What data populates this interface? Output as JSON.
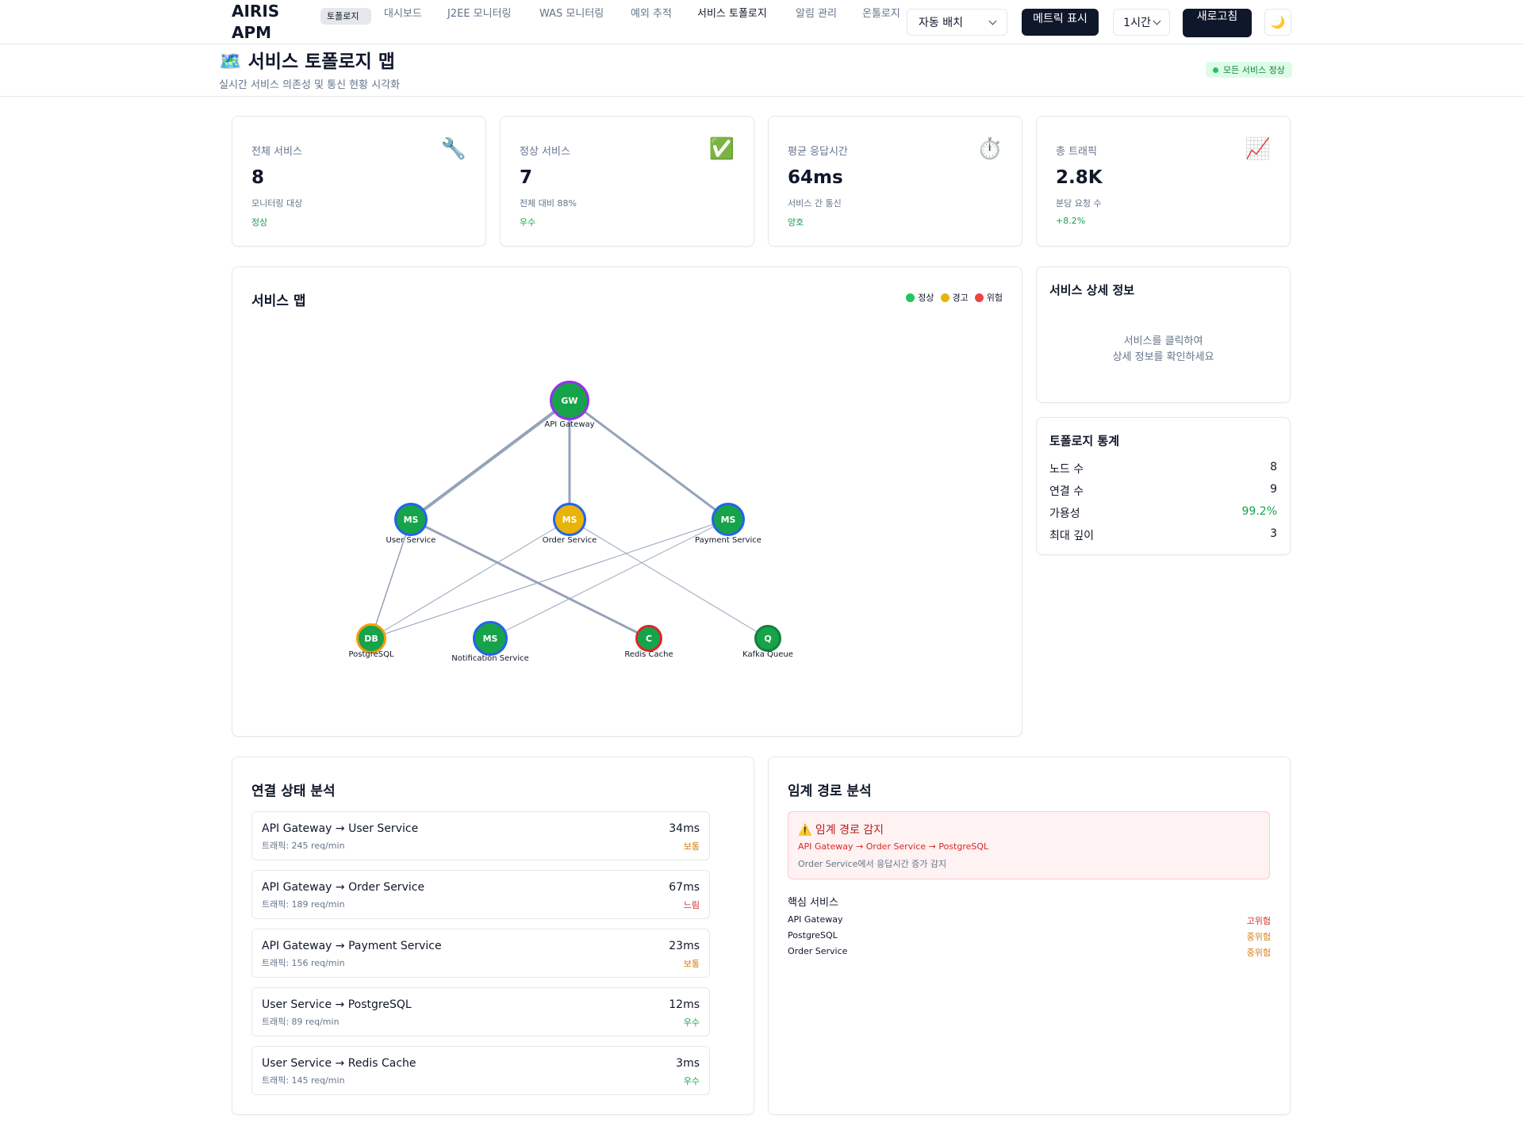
{
  "nav": {
    "logo": "AIRIS APM",
    "items": [
      "토폴로지",
      "대시보드",
      "J2EE 모니터링",
      "WAS 모니터링",
      "예외 추적",
      "서비스 토폴로지",
      "알림 관리",
      "온톨로지"
    ],
    "layout_select": "자동 배치",
    "metrics_button": "메트릭 표시",
    "time_select": "1시간",
    "refresh_button": "새로고침",
    "theme_icon": "🌙"
  },
  "header": {
    "title": "🗺️ 서비스 토폴로지 맵",
    "subtitle": "실시간 서비스 의존성 및 통신 현황 시각화",
    "status_badge": "모든 서비스 정상"
  },
  "stats": [
    {
      "label": "전체 서비스",
      "icon": "🔧",
      "value": "8",
      "sub": "모니터링 대상",
      "trend": "정상"
    },
    {
      "label": "정상 서비스",
      "icon": "✅",
      "value": "7",
      "sub": "전체 대비 88%",
      "trend": "우수"
    },
    {
      "label": "평균 응답시간",
      "icon": "⏱️",
      "value": "64ms",
      "sub": "서비스 간 통신",
      "trend": "양호"
    },
    {
      "label": "총 트래픽",
      "icon": "📈",
      "value": "2.8K",
      "sub": "분당 요청 수",
      "trend": "+8.2%"
    }
  ],
  "map": {
    "title": "서비스 맵",
    "legend": [
      {
        "label": "정상",
        "color": "#22c55e"
      },
      {
        "label": "경고",
        "color": "#eab308"
      },
      {
        "label": "위험",
        "color": "#ef4444"
      }
    ],
    "nodes": [
      {
        "id": "gw",
        "abbr": "GW",
        "name": "API Gateway",
        "fill": "#16a34a",
        "ring": "#9333ea"
      },
      {
        "id": "user",
        "abbr": "MS",
        "name": "User Service",
        "fill": "#16a34a",
        "ring": "#2563eb"
      },
      {
        "id": "order",
        "abbr": "MS",
        "name": "Order Service",
        "fill": "#eab308",
        "ring": "#2563eb"
      },
      {
        "id": "pay",
        "abbr": "MS",
        "name": "Payment Service",
        "fill": "#16a34a",
        "ring": "#2563eb"
      },
      {
        "id": "pg",
        "abbr": "DB",
        "name": "PostgreSQL",
        "fill": "#16a34a",
        "ring": "#f59e0b"
      },
      {
        "id": "notif",
        "abbr": "MS",
        "name": "Notification Service",
        "fill": "#16a34a",
        "ring": "#2563eb"
      },
      {
        "id": "redis",
        "abbr": "C",
        "name": "Redis Cache",
        "fill": "#16a34a",
        "ring": "#dc2626"
      },
      {
        "id": "kafka",
        "abbr": "Q",
        "name": "Kafka Queue",
        "fill": "#16a34a",
        "ring": "#15803d"
      }
    ]
  },
  "detail": {
    "title": "서비스 상세 정보",
    "placeholder_line1": "서비스를 클릭하여",
    "placeholder_line2": "상세 정보를 확인하세요"
  },
  "topology_stats": {
    "title": "토폴로지 통계",
    "rows": [
      {
        "label": "노드 수",
        "value": "8"
      },
      {
        "label": "연결 수",
        "value": "9"
      },
      {
        "label": "가용성",
        "value": "99.2%"
      },
      {
        "label": "최대 깊이",
        "value": "3"
      }
    ]
  },
  "connections": {
    "title": "연결 상태 분석",
    "items": [
      {
        "name": "API Gateway → User Service",
        "traffic": "트래픽: 245 req/min",
        "latency": "34ms",
        "status": "보통",
        "status_color": "#d97706"
      },
      {
        "name": "API Gateway → Order Service",
        "traffic": "트래픽: 189 req/min",
        "latency": "67ms",
        "status": "느림",
        "status_color": "#dc2626"
      },
      {
        "name": "API Gateway → Payment Service",
        "traffic": "트래픽: 156 req/min",
        "latency": "23ms",
        "status": "보통",
        "status_color": "#d97706"
      },
      {
        "name": "User Service → PostgreSQL",
        "traffic": "트래픽: 89 req/min",
        "latency": "12ms",
        "status": "우수",
        "status_color": "#16a34a"
      },
      {
        "name": "User Service → Redis Cache",
        "traffic": "트래픽: 145 req/min",
        "latency": "3ms",
        "status": "우수",
        "status_color": "#16a34a"
      }
    ]
  },
  "critical": {
    "title": "임계 경로 분석",
    "alert_title": "⚠️ 임계 경로 감지",
    "alert_path": "API Gateway → Order Service → PostgreSQL",
    "alert_desc": "Order Service에서 응답시간 증가 감지",
    "core_label": "핵심 서비스",
    "core": [
      {
        "name": "API Gateway",
        "risk": "고위험",
        "color": "#dc2626"
      },
      {
        "name": "PostgreSQL",
        "risk": "중위험",
        "color": "#d97706"
      },
      {
        "name": "Order Service",
        "risk": "중위험",
        "color": "#d97706"
      }
    ]
  }
}
